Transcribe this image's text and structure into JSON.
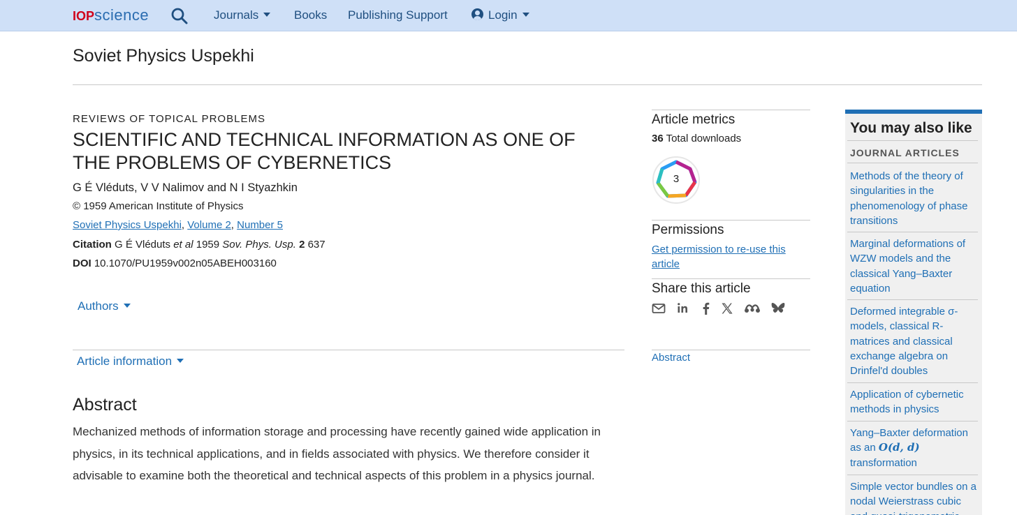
{
  "nav": {
    "logo_iop": "IOP",
    "logo_science": "science",
    "items": [
      "Journals",
      "Books",
      "Publishing Support",
      "Login"
    ]
  },
  "journal_title": "Soviet Physics Uspekhi",
  "article": {
    "section": "REVIEWS OF TOPICAL PROBLEMS",
    "title": "SCIENTIFIC AND TECHNICAL INFORMATION AS ONE OF THE PROBLEMS OF CYBERNETICS",
    "authors": "G É Vléduts, V V Nalimov and N I Styazhkin",
    "copyright": "© 1959 American Institute of Physics",
    "journal_link": "Soviet Physics Uspekhi",
    "volume_link": "Volume 2",
    "number_link": "Number 5",
    "citation_label": "Citation",
    "citation_authors": "G É Vléduts",
    "citation_etal": "et al",
    "citation_year": "1959",
    "citation_journal": "Sov. Phys. Usp.",
    "citation_volume": "2",
    "citation_page": "637",
    "doi_label": "DOI",
    "doi": "10.1070/PU1959v002n05ABEH003160",
    "authors_toggle": "Authors",
    "info_toggle": "Article information",
    "abstract_heading": "Abstract",
    "abstract_text": "Mechanized methods of information storage and processing have recently gained wide application in physics, in its technical applications, and in fields associated with physics. We therefore consider it advisable to examine both the theoretical and technical aspects of this problem in a physics journal."
  },
  "metrics": {
    "heading": "Article metrics",
    "downloads_count": "36",
    "downloads_label": "Total downloads",
    "altmetric_score": "3"
  },
  "permissions": {
    "heading": "Permissions",
    "link": "Get permission to re-use this article"
  },
  "share": {
    "heading": "Share this article",
    "icons": [
      "email-icon",
      "linkedin-icon",
      "facebook-icon",
      "x-icon",
      "mendeley-icon",
      "bluesky-icon"
    ]
  },
  "abstract_anchor": "Abstract",
  "also_like": {
    "heading": "You may also like",
    "subheading": "JOURNAL ARTICLES",
    "items": [
      {
        "pre": "Methods of the theory of singularities in the phenomenology of phase transitions",
        "math": "",
        "post": ""
      },
      {
        "pre": "Marginal deformations of WZW models and the classical Yang–Baxter equation",
        "math": "",
        "post": ""
      },
      {
        "pre": "Deformed integrable σ-models, classical R-matrices and classical exchange algebra on Drinfel'd doubles",
        "math": "",
        "post": ""
      },
      {
        "pre": "Application of cybernetic methods in physics",
        "math": "",
        "post": ""
      },
      {
        "pre": "Yang–Baxter deformation as an ",
        "math": "O(d, d)",
        "post": " transformation"
      },
      {
        "pre": "Simple vector bundles on a nodal Weierstrass cubic and quasi-trigonometric",
        "math": "",
        "post": ""
      }
    ]
  },
  "colors": {
    "topbar": "#cfe0f7",
    "link": "#1f6fb5",
    "nav_text": "#1f4f80",
    "logo_red": "#d0021b"
  }
}
